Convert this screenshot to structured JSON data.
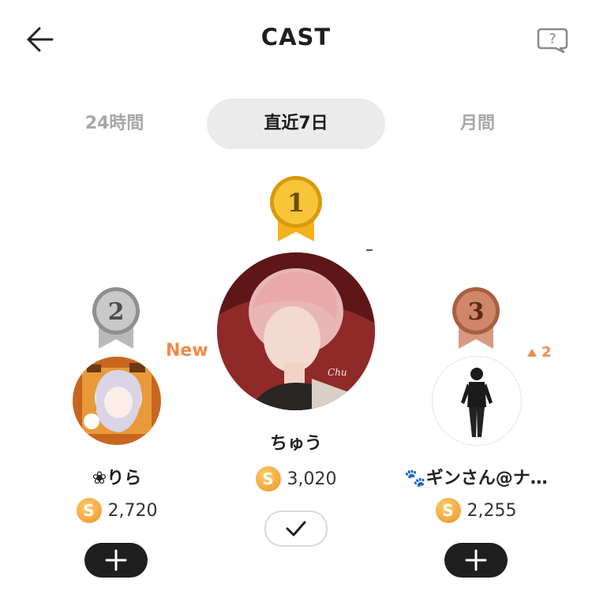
{
  "header": {
    "title": "CAST"
  },
  "tabs": [
    {
      "label": "24時間",
      "active": false
    },
    {
      "label": "直近7日",
      "active": true
    },
    {
      "label": "月間",
      "active": false
    }
  ],
  "ranking": [
    {
      "rank": "1",
      "name": "ちゅう",
      "score": "3,020",
      "action": "check"
    },
    {
      "rank": "2",
      "name": "❀りら",
      "score": "2,720",
      "badge": "New",
      "action": "add"
    },
    {
      "rank": "3",
      "name": "🐾ギンさん@ナ…",
      "score": "2,255",
      "change": "2",
      "action": "add"
    }
  ],
  "coin_symbol": "S",
  "colors": {
    "accent": "#ef8a4a",
    "gold": "#f4b21d",
    "silver": "#a6a6a6",
    "bronze": "#c9876a"
  }
}
